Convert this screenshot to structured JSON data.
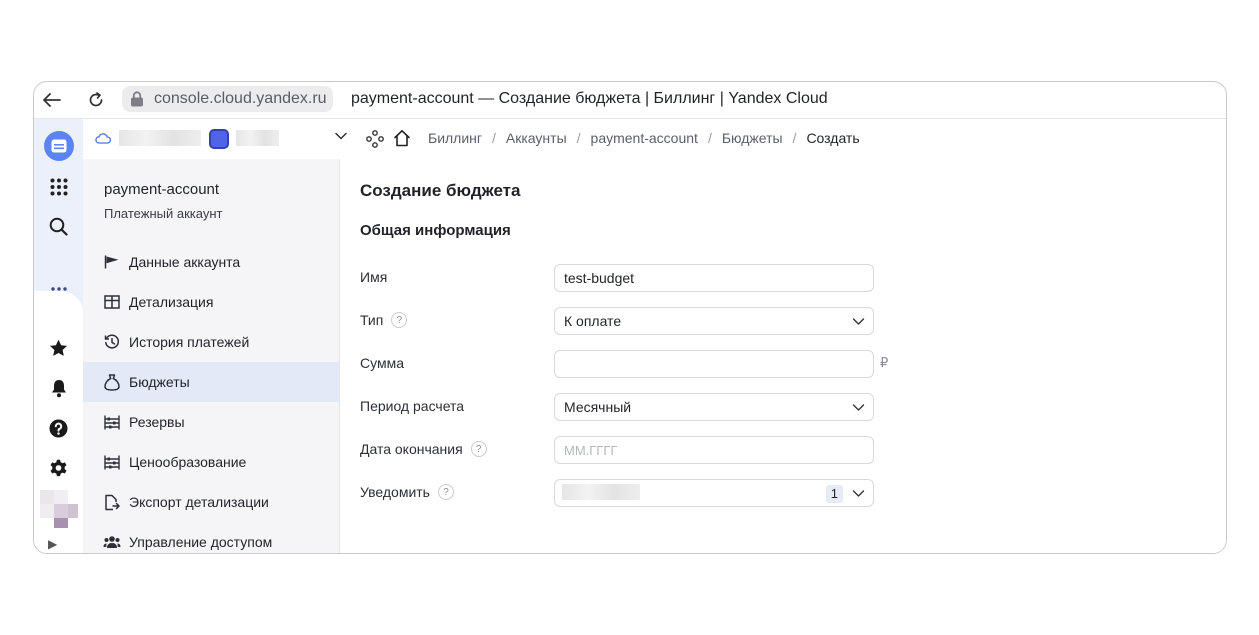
{
  "browser": {
    "url": "console.cloud.yandex.ru",
    "title": "payment-account — Создание бюджета | Биллинг | Yandex Cloud"
  },
  "rail": {
    "icons": [
      "console-logo-icon",
      "apps-grid-icon",
      "search-icon",
      "more-icon",
      "star-icon",
      "bell-icon",
      "help-icon",
      "gear-icon"
    ],
    "expand_glyph": "▶"
  },
  "breadcrumbs": [
    "Биллинг",
    "Аккаунты",
    "payment-account",
    "Бюджеты",
    "Создать"
  ],
  "sidebar": {
    "account_name": "payment-account",
    "account_type": "Платежный аккаунт",
    "items": [
      {
        "label": "Данные аккаунта",
        "icon": "flag-icon"
      },
      {
        "label": "Детализация",
        "icon": "table-icon"
      },
      {
        "label": "История платежей",
        "icon": "history-icon"
      },
      {
        "label": "Бюджеты",
        "icon": "money-bag-icon",
        "active": true
      },
      {
        "label": "Резервы",
        "icon": "abacus-icon"
      },
      {
        "label": "Ценообразование",
        "icon": "abacus-icon"
      },
      {
        "label": "Экспорт детализации",
        "icon": "file-export-icon"
      },
      {
        "label": "Управление доступом",
        "icon": "users-icon"
      }
    ]
  },
  "form": {
    "title": "Создание бюджета",
    "section": "Общая информация",
    "name_label": "Имя",
    "name_value": "test-budget",
    "type_label": "Тип",
    "type_value": "К оплате",
    "sum_label": "Сумма",
    "sum_value": "",
    "currency": "₽",
    "period_label": "Период расчета",
    "period_value": "Месячный",
    "end_date_label": "Дата окончания",
    "end_date_placeholder": "ММ.ГГГГ",
    "notify_label": "Уведомить",
    "notify_count": "1",
    "help_glyph": "?"
  },
  "colors": {
    "accent": "#5c83f2",
    "rail_bg": "#ebf0fb",
    "active_item_bg": "#e3e9f7",
    "sidebar_bg": "#f5f5f7"
  }
}
